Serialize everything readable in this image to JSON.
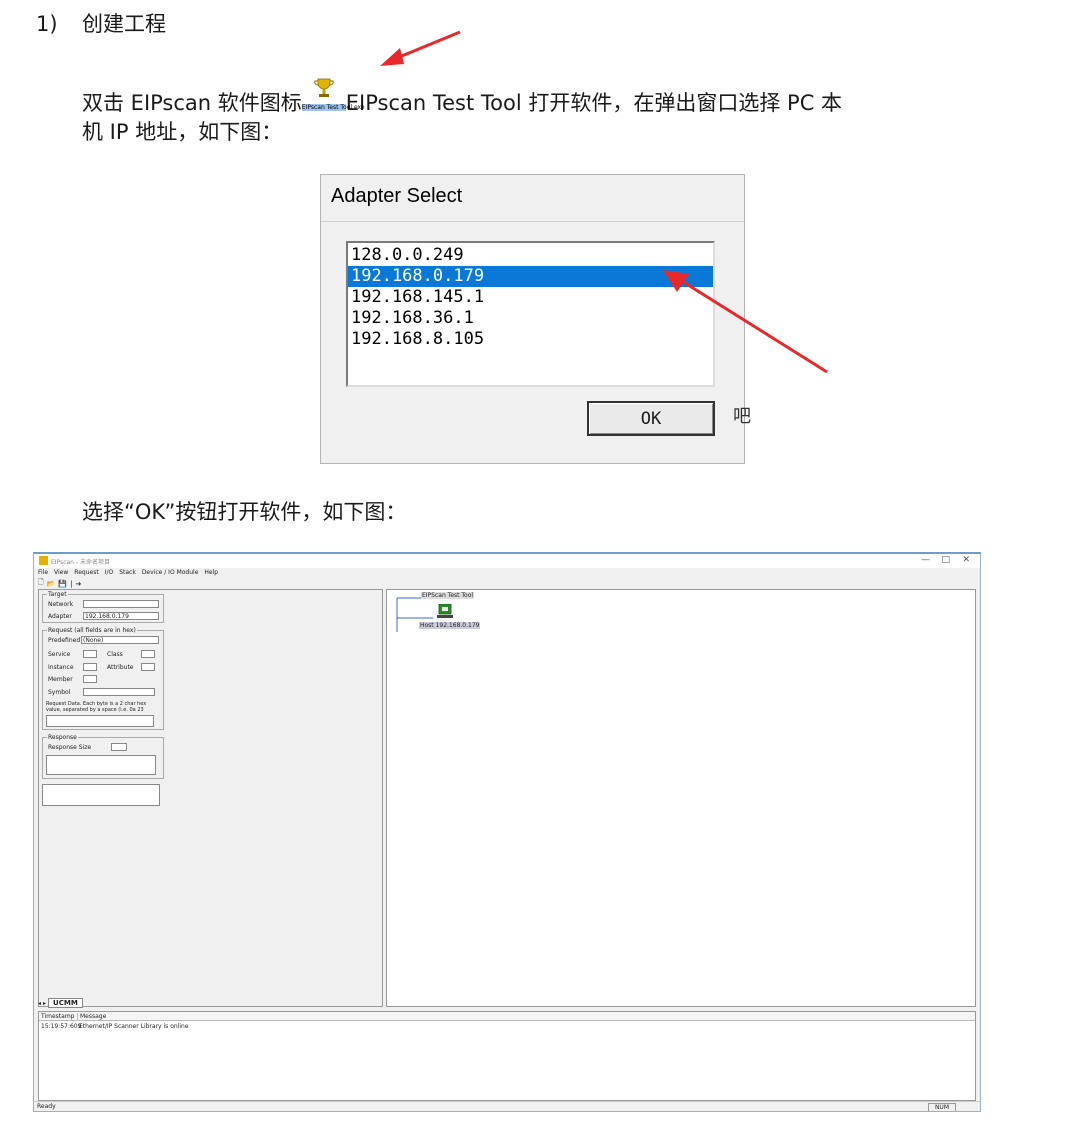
{
  "heading": {
    "number": "1)",
    "text": "创建工程"
  },
  "para1": {
    "before": "双击 EIPscan 软件图标",
    "after": "EIPscan Test Tool 打开软件，在弹出窗口选择 PC 本"
  },
  "para2": "机 IP 地址，如下图：",
  "desktop_icon_caption": "EIPscan Test Tool.exe",
  "dialog": {
    "title": "Adapter Select",
    "adapters": [
      "128.0.0.249",
      "192.168.0.179",
      "192.168.145.1",
      "192.168.36.1",
      "192.168.8.105"
    ],
    "ok_label": "OK",
    "right_fragment": "吧"
  },
  "para3": "选择“OK”按钮打开软件，如下图：",
  "app": {
    "title": "EIPscan - 未命名项目",
    "window_controls": [
      "—",
      "□",
      "✕"
    ],
    "menu": [
      "File",
      "View",
      "Request",
      "I/O",
      "Stack",
      "Device / IO Module",
      "Help"
    ],
    "target": {
      "legend": "Target",
      "network_label": "Network",
      "adapter_label": "Adapter",
      "adapter_value": "192.168.0.179"
    },
    "request": {
      "legend": "Request (all fields are in hex)",
      "predefined_label": "Predefined",
      "predefined_value": "(None)",
      "service_label": "Service",
      "class_label": "Class",
      "instance_label": "Instance",
      "attribute_label": "Attribute",
      "member_label": "Member",
      "symbol_label": "Symbol",
      "data_hint": "Request Data. Each byte is a 2 char hex value, separated by a space (i.e. 0a 23"
    },
    "response": {
      "legend": "Response",
      "size_label": "Response Size"
    },
    "tree": {
      "root": "EIPScan Test Tool",
      "host": "Host 192.168.0.179"
    },
    "tab_label": "UCMM",
    "log": {
      "col_timestamp": "Timestamp",
      "col_message": "Message",
      "rows": [
        {
          "timestamp": "15:19:57:609",
          "message": "Ethernet/IP Scanner Library is online"
        }
      ]
    },
    "status": {
      "ready": "Ready",
      "num": "NUM"
    }
  }
}
